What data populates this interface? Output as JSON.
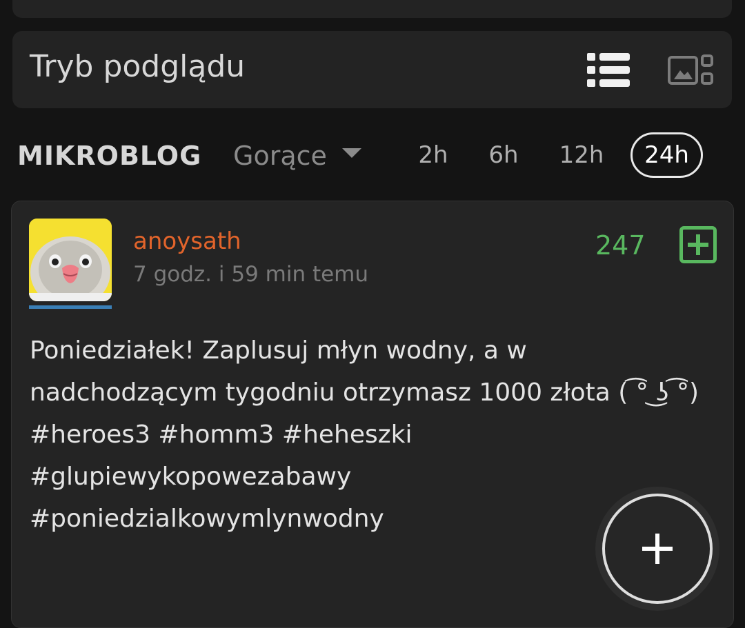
{
  "preview": {
    "title": "Tryb podglądu",
    "list_view_icon": "list-icon",
    "image_view_icon": "image-grid-icon"
  },
  "filters": {
    "section": "MIKROBLOG",
    "sort": "Gorące",
    "periods": [
      "2h",
      "6h",
      "12h",
      "24h"
    ],
    "active_period": "24h"
  },
  "post": {
    "username": "anoysath",
    "time": "7 godz. i 59 min temu",
    "votes": "247",
    "body_line1": "Poniedziałek! Zaplusuj młyn wodny, a w nadchodzącym tygodniu otrzymasz 1000 złota ( ͡° ͜ʖ ͡°)",
    "tags": [
      "#heroes3 #homm3 #heheszki",
      "#glupiewykopowezabawy",
      "#poniedzialkowymlynwodny"
    ]
  },
  "colors": {
    "username": "#e2642b",
    "votes": "#59b85f",
    "avatar_underline": "#3a7fb6"
  },
  "fab_icon": "plus-icon"
}
